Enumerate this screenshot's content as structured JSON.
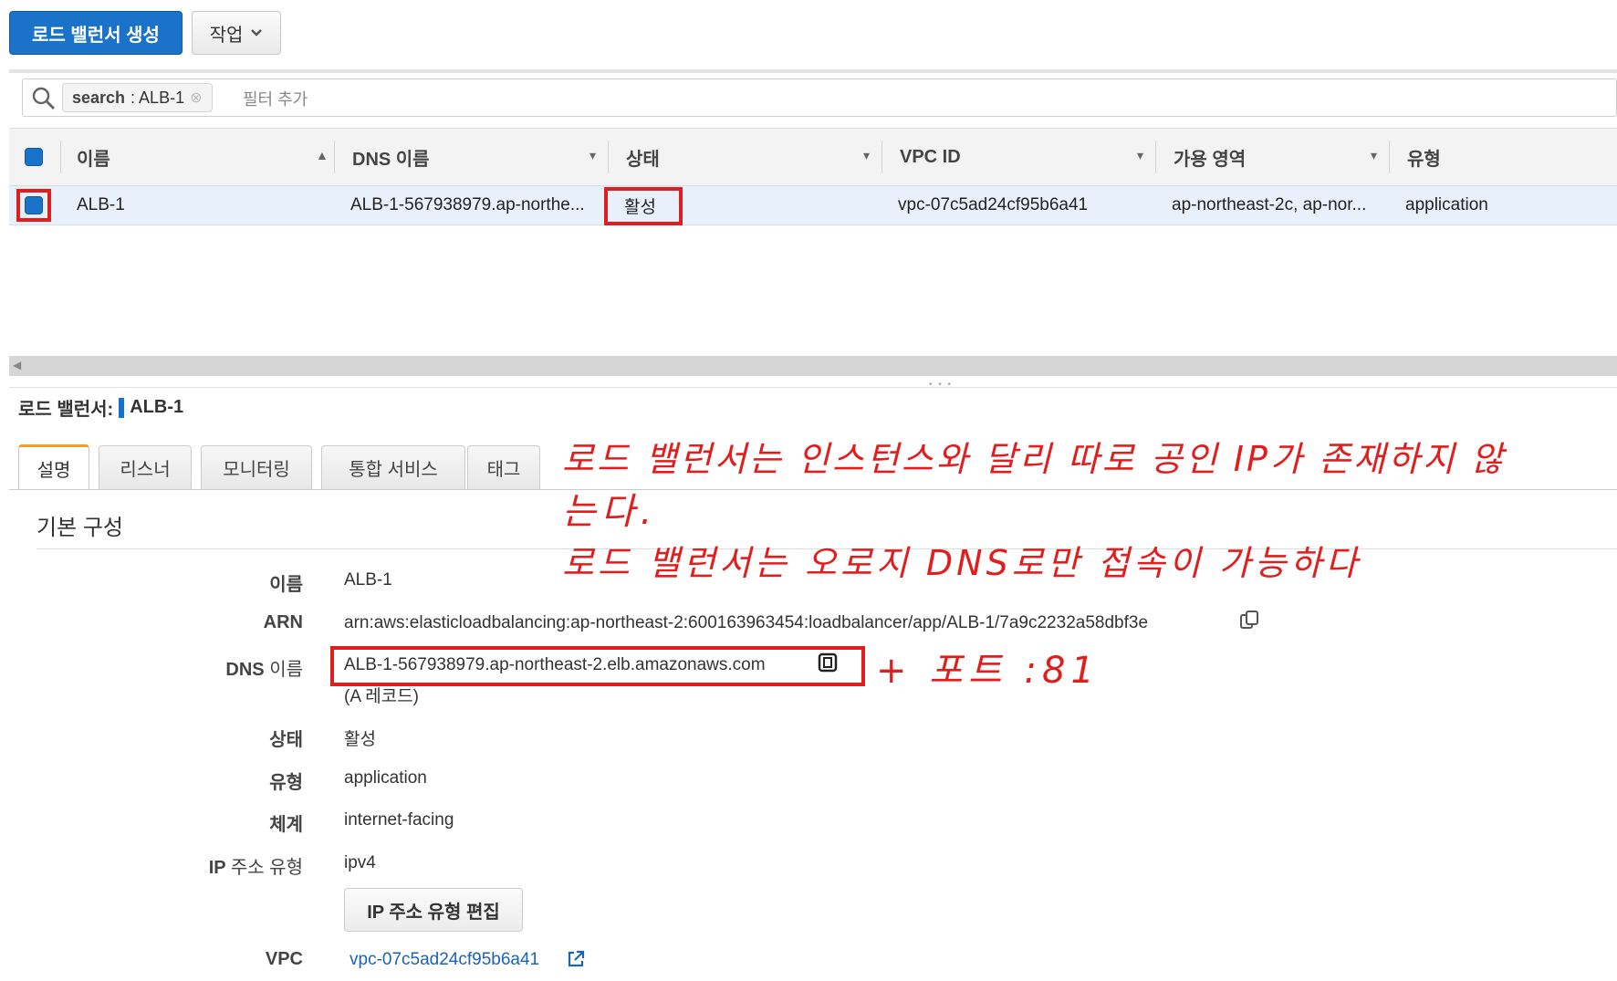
{
  "toolbar": {
    "create_label": "로드 밸런서 생성",
    "actions_label": "작업"
  },
  "filter": {
    "token_key": "search",
    "token_value": ": ALB-1",
    "placeholder": "필터 추가"
  },
  "table": {
    "headers": [
      "이름",
      "DNS 이름",
      "상태",
      "VPC ID",
      "가용 영역",
      "유형"
    ],
    "row": {
      "name": "ALB-1",
      "dns": "ALB-1-567938979.ap-northe...",
      "state": "활성",
      "vpc": "vpc-07c5ad24cf95b6a41",
      "az": "ap-northeast-2c, ap-nor...",
      "type": "application"
    }
  },
  "detail": {
    "prefix": "로드 밸런서:",
    "name": "ALB-1",
    "tabs": [
      "설명",
      "리스너",
      "모니터링",
      "통합 서비스",
      "태그"
    ],
    "section_title": "기본 구성",
    "fields": {
      "name_label": "이름",
      "name_value": "ALB-1",
      "arn_label": "ARN",
      "arn_value": "arn:aws:elasticloadbalancing:ap-northeast-2:600163963454:loadbalancer/app/ALB-1/7a9c2232a58dbf3e",
      "dns_label_en": "DNS",
      "dns_label_ko": "이름",
      "dns_value": "ALB-1-567938979.ap-northeast-2.elb.amazonaws.com",
      "dns_note": "(A 레코드)",
      "state_label": "상태",
      "state_value": "활성",
      "type_label": "유형",
      "type_value": "application",
      "scheme_label": "체계",
      "scheme_value": "internet-facing",
      "ip_label_en": "IP",
      "ip_label_ko": "주소 유형",
      "ip_value": "ipv4",
      "edit_ip_button": "IP 주소 유형 편집",
      "vpc_label": "VPC",
      "vpc_value": "vpc-07c5ad24cf95b6a41"
    }
  },
  "annotations": {
    "line1": "로드 밸런서는 인스턴스와 달리 따로 공인 IP가 존재하지 않",
    "line2": "는다.",
    "line3": "로드 밸런서는 오로지 DNS로만 접속이 가능하다",
    "port_note": "+ 포트 :81"
  },
  "colors": {
    "accent": "#1a73c9",
    "highlight": "#e01e1e",
    "selected_row": "#e8f1fb"
  }
}
